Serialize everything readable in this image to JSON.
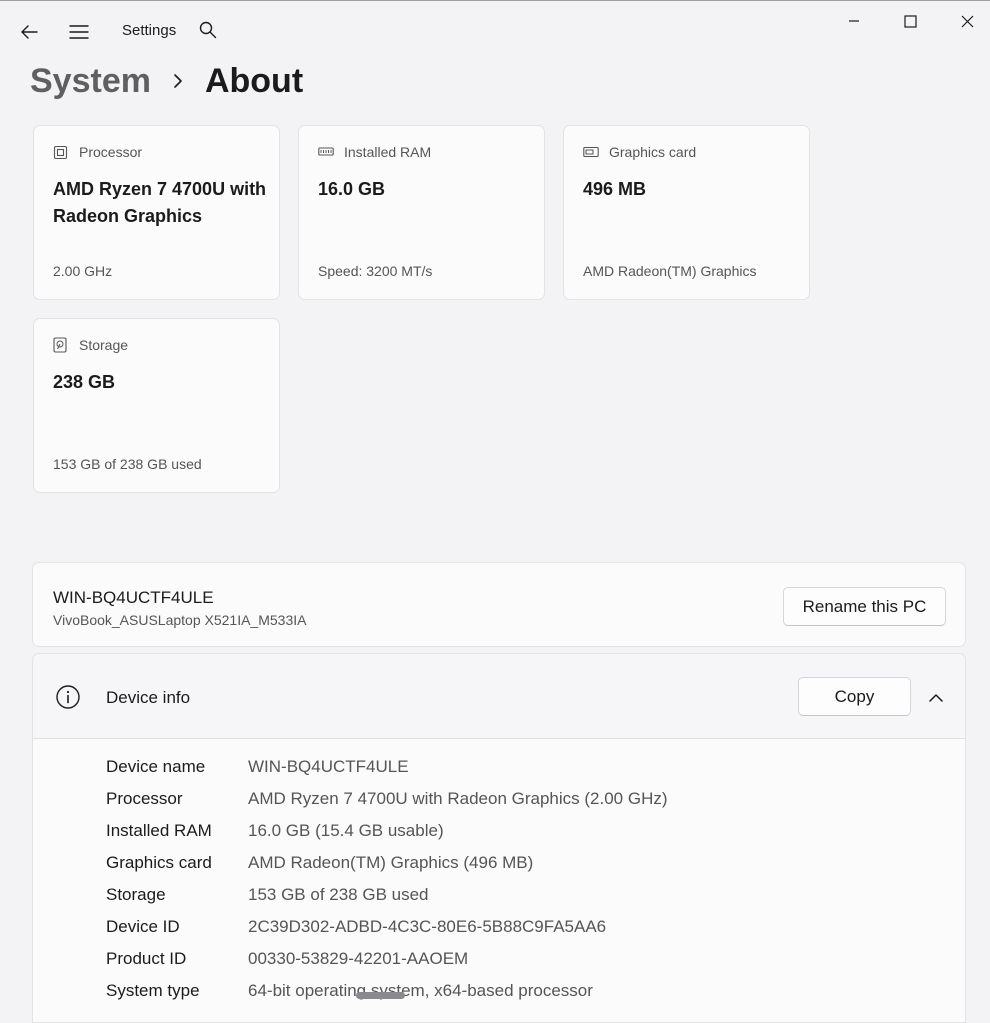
{
  "app": {
    "title": "Settings"
  },
  "breadcrumb": {
    "parent": "System",
    "current": "About"
  },
  "specs": [
    {
      "icon": "processor-icon",
      "label": "Processor",
      "value": "AMD Ryzen 7 4700U with Radeon Graphics",
      "detail": "2.00 GHz"
    },
    {
      "icon": "ram-icon",
      "label": "Installed RAM",
      "value": "16.0 GB",
      "detail": "Speed: 3200 MT/s"
    },
    {
      "icon": "graphics-card-icon",
      "label": "Graphics card",
      "value": "496 MB",
      "detail": "AMD Radeon(TM) Graphics"
    },
    {
      "icon": "storage-icon",
      "label": "Storage",
      "value": "238 GB",
      "detail": "153 GB of 238 GB used"
    }
  ],
  "pc": {
    "name": "WIN-BQ4UCTF4ULE",
    "model": "VivoBook_ASUSLaptop X521IA_M533IA",
    "rename_label": "Rename this PC"
  },
  "device_info": {
    "title": "Device info",
    "copy_label": "Copy",
    "rows": [
      {
        "label": "Device name",
        "value": "WIN-BQ4UCTF4ULE"
      },
      {
        "label": "Processor",
        "value": "AMD Ryzen 7 4700U with Radeon Graphics (2.00 GHz)"
      },
      {
        "label": "Installed RAM",
        "value": "16.0 GB (15.4 GB usable)"
      },
      {
        "label": "Graphics card",
        "value": "AMD Radeon(TM) Graphics (496 MB)"
      },
      {
        "label": "Storage",
        "value": "153 GB of 238 GB used"
      },
      {
        "label": "Device ID",
        "value": "2C39D302-ADBD-4C3C-80E6-5B88C9FA5AA6"
      },
      {
        "label": "Product ID",
        "value": "00330-53829-42201-AAOEM"
      },
      {
        "label": "System type",
        "value": "64-bit operating system, x64-based processor"
      }
    ]
  }
}
